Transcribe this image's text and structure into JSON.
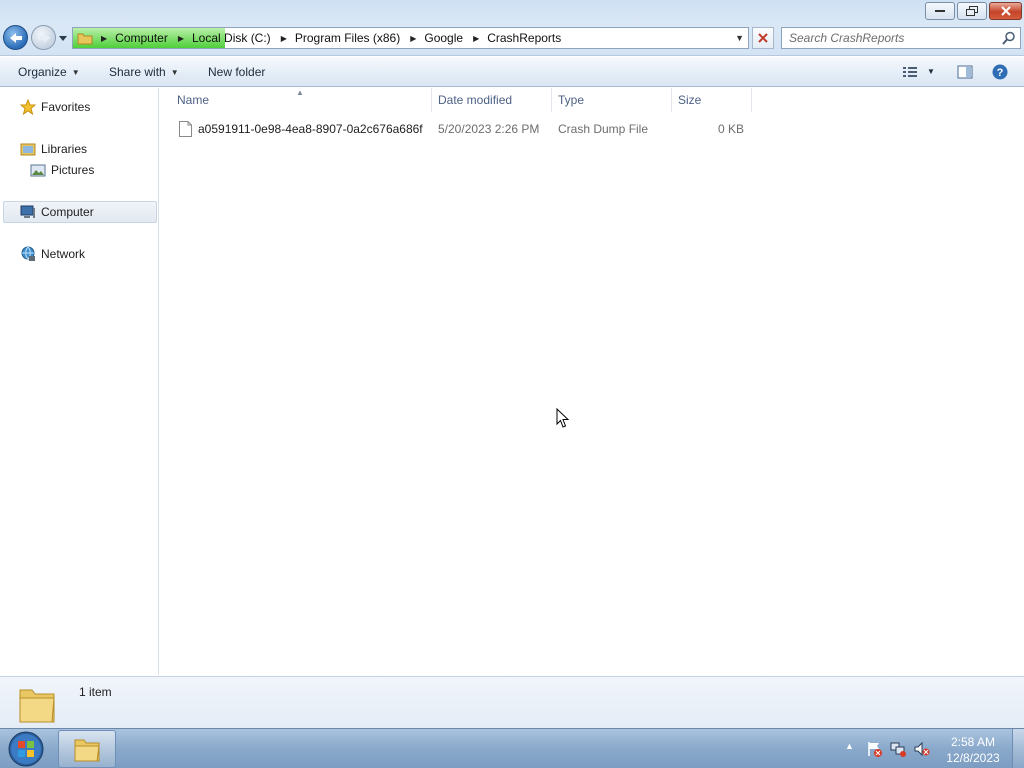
{
  "window": {
    "minimize": "minimize",
    "maximize": "restore",
    "close": "close"
  },
  "address": {
    "segments": [
      "Computer",
      "Local Disk (C:)",
      "Program Files (x86)",
      "Google",
      "CrashReports"
    ]
  },
  "search": {
    "placeholder": "Search CrashReports"
  },
  "toolbar": {
    "organize": "Organize",
    "share_with": "Share with",
    "new_folder": "New folder"
  },
  "nav": {
    "favorites": "Favorites",
    "libraries": "Libraries",
    "pictures": "Pictures",
    "computer": "Computer",
    "network": "Network"
  },
  "columns": {
    "name": "Name",
    "date_modified": "Date modified",
    "type": "Type",
    "size": "Size"
  },
  "files": [
    {
      "name": "a0591911-0e98-4ea8-8907-0a2c676a686f",
      "date_modified": "5/20/2023 2:26 PM",
      "type": "Crash Dump File",
      "size": "0 KB"
    }
  ],
  "status": {
    "item_count": "1 item"
  },
  "taskbar": {
    "time": "2:58 AM",
    "date": "12/8/2023"
  },
  "colors": {
    "accent": "#2b6cb8",
    "address_progress": "#4fcf3a",
    "taskbar": "#8aa9cb"
  }
}
